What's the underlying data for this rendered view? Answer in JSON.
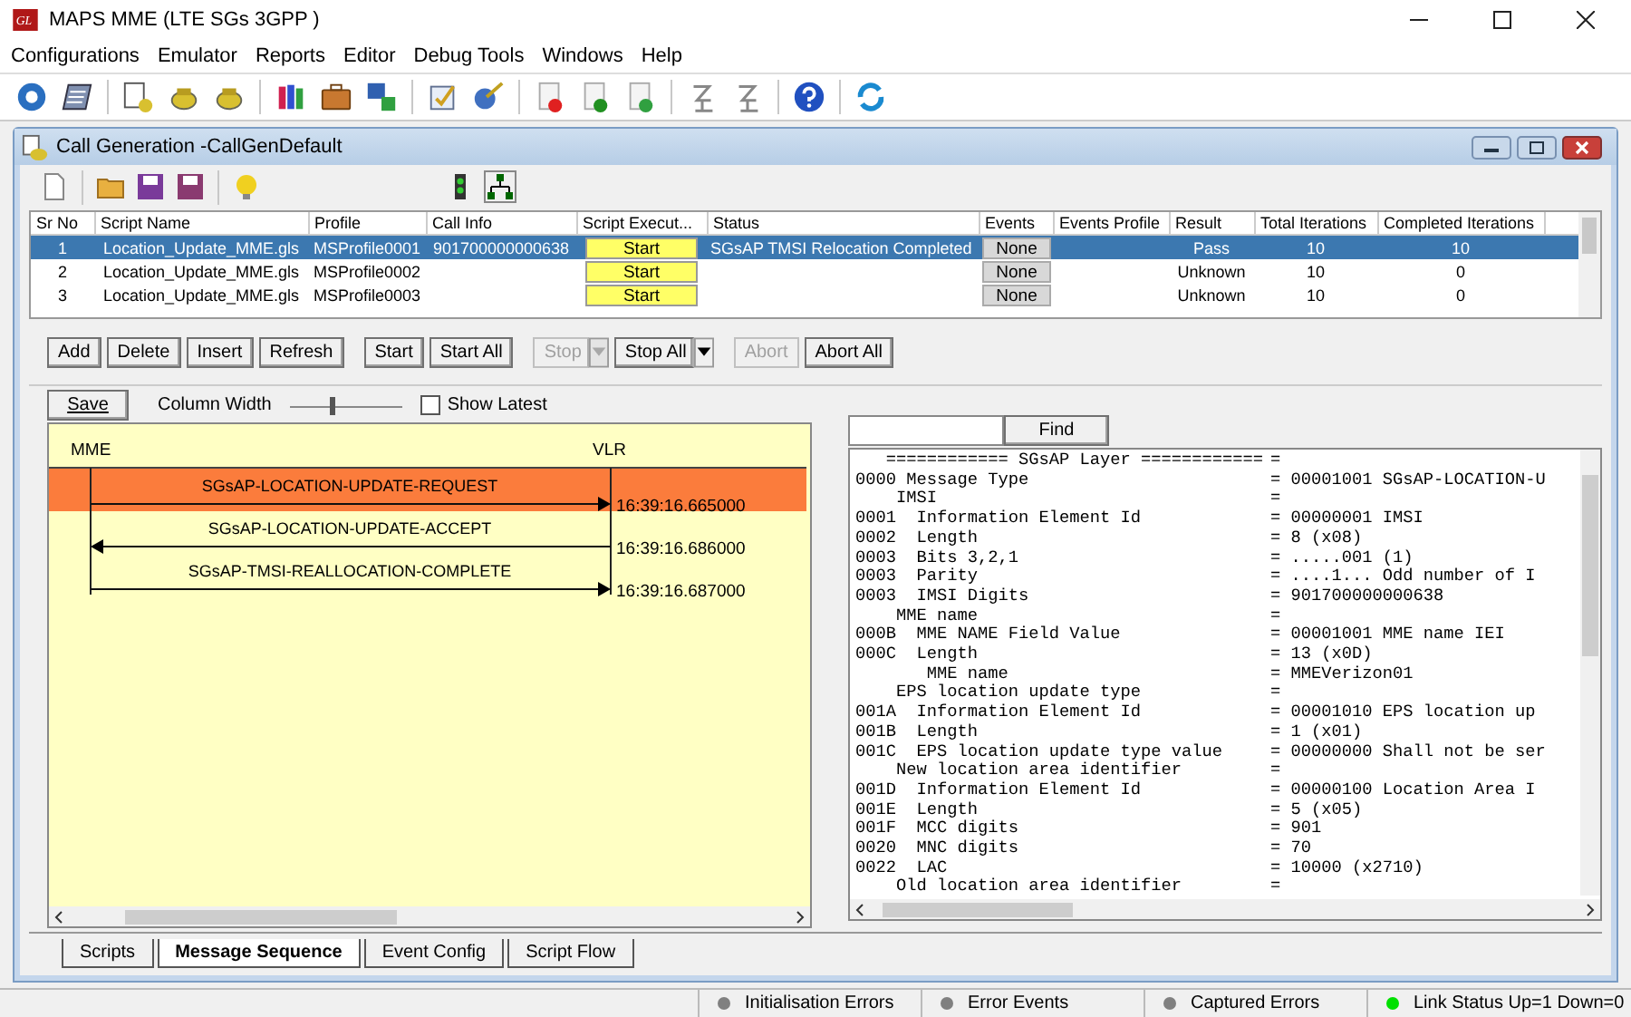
{
  "window": {
    "logo": "GL",
    "title": "MAPS MME (LTE SGs 3GPP )"
  },
  "menu": [
    "Configurations",
    "Emulator",
    "Reports",
    "Editor",
    "Debug Tools",
    "Windows",
    "Help"
  ],
  "child_window": {
    "title": "Call Generation  -CallGenDefault"
  },
  "table": {
    "columns": [
      "Sr No",
      "Script Name",
      "Profile",
      "Call Info",
      "Script Execut...",
      "Status",
      "Events",
      "Events Profile",
      "Result",
      "Total Iterations",
      "Completed Iterations"
    ],
    "rows": [
      {
        "selected": true,
        "sr_no": "1",
        "script_name": "Location_Update_MME.gls",
        "profile": "MSProfile0001",
        "call_info": "901700000000638",
        "script_execution": "Start",
        "status": "SGsAP TMSI Relocation Completed",
        "events": "None",
        "events_profile": "",
        "result": "Pass",
        "total_iterations": "10",
        "completed_iterations": "10"
      },
      {
        "selected": false,
        "sr_no": "2",
        "script_name": "Location_Update_MME.gls",
        "profile": "MSProfile0002",
        "call_info": "",
        "script_execution": "Start",
        "status": "",
        "events": "None",
        "events_profile": "",
        "result": "Unknown",
        "total_iterations": "10",
        "completed_iterations": "0"
      },
      {
        "selected": false,
        "sr_no": "3",
        "script_name": "Location_Update_MME.gls",
        "profile": "MSProfile0003",
        "call_info": "",
        "script_execution": "Start",
        "status": "",
        "events": "None",
        "events_profile": "",
        "result": "Unknown",
        "total_iterations": "10",
        "completed_iterations": "0"
      }
    ]
  },
  "button_groups": [
    [
      {
        "label": "Add",
        "disabled": false,
        "dropdown": false
      },
      {
        "label": "Delete",
        "disabled": false,
        "dropdown": false
      },
      {
        "label": "Insert",
        "disabled": false,
        "dropdown": false
      },
      {
        "label": "Refresh",
        "disabled": false,
        "dropdown": false
      }
    ],
    [
      {
        "label": "Start",
        "disabled": false,
        "dropdown": false
      },
      {
        "label": "Start All",
        "disabled": false,
        "dropdown": false
      }
    ],
    [
      {
        "label": "Stop",
        "disabled": true,
        "dropdown": true
      },
      {
        "label": "Stop All",
        "disabled": false,
        "dropdown": true
      }
    ],
    [
      {
        "label": "Abort",
        "disabled": true,
        "dropdown": false
      },
      {
        "label": "Abort All",
        "disabled": false,
        "dropdown": false
      }
    ]
  ],
  "sequence_panel": {
    "save_button": "Save",
    "column_width_label": "Column Width",
    "column_width": {
      "level": 0.4
    },
    "show_latest": {
      "label": "Show Latest",
      "checked": false
    },
    "entities": [
      "MME",
      "VLR"
    ],
    "messages": [
      {
        "label": "SGsAP-LOCATION-UPDATE-REQUEST",
        "kind": "rightward",
        "time": "16:39:16.665000",
        "selected": true
      },
      {
        "label": "SGsAP-LOCATION-UPDATE-ACCEPT",
        "kind": "leftward",
        "time": "16:39:16.686000",
        "selected": false
      },
      {
        "label": "SGsAP-TMSI-REALLOCATION-COMPLETE",
        "kind": "rightward",
        "time": "16:39:16.687000",
        "selected": false
      }
    ]
  },
  "decode_panel": {
    "find_button": "Find",
    "lines": [
      {
        "field": "   ============ SGsAP Layer ============",
        "value": "="
      },
      {
        "field": "0000 Message Type",
        "value": "= 00001001 SGsAP-LOCATION-U"
      },
      {
        "field": "    IMSI",
        "value": "="
      },
      {
        "field": "0001  Information Element Id",
        "value": "= 00000001 IMSI"
      },
      {
        "field": "0002  Length",
        "value": "= 8 (x08)"
      },
      {
        "field": "0003  Bits 3,2,1",
        "value": "= .....001 (1)"
      },
      {
        "field": "0003  Parity",
        "value": "= ....1... Odd number of I"
      },
      {
        "field": "0003  IMSI Digits",
        "value": "= 901700000000638"
      },
      {
        "field": "    MME name",
        "value": "="
      },
      {
        "field": "000B  MME NAME Field Value",
        "value": "= 00001001 MME name IEI"
      },
      {
        "field": "000C  Length",
        "value": "= 13 (x0D)"
      },
      {
        "field": "       MME name",
        "value": "= MMEVerizon01"
      },
      {
        "field": "    EPS location update type",
        "value": "="
      },
      {
        "field": "001A  Information Element Id",
        "value": "= 00001010 EPS location up"
      },
      {
        "field": "001B  Length",
        "value": "= 1 (x01)"
      },
      {
        "field": "001C  EPS location update type value",
        "value": "= 00000000 Shall not be ser"
      },
      {
        "field": "    New location area identifier",
        "value": "="
      },
      {
        "field": "001D  Information Element Id",
        "value": "= 00000100 Location Area I"
      },
      {
        "field": "001E  Length",
        "value": "= 5 (x05)"
      },
      {
        "field": "001F  MCC digits",
        "value": "= 901"
      },
      {
        "field": "0020  MNC digits",
        "value": "= 70"
      },
      {
        "field": "0022  LAC",
        "value": "= 10000 (x2710)"
      },
      {
        "field": "    Old location area identifier",
        "value": "="
      }
    ]
  },
  "tabs": [
    {
      "label": "Scripts",
      "selected": false
    },
    {
      "label": "Message Sequence",
      "selected": true
    },
    {
      "label": "Event Config",
      "selected": false
    },
    {
      "label": "Script Flow",
      "selected": false
    }
  ],
  "status_bar": [
    {
      "label": "Initialisation Errors",
      "color": "#808080"
    },
    {
      "label": "Error Events",
      "color": "#808080"
    },
    {
      "label": "Captured Errors",
      "color": "#808080"
    },
    {
      "label": "Link Status Up=1 Down=0",
      "color": "#00e000"
    }
  ]
}
